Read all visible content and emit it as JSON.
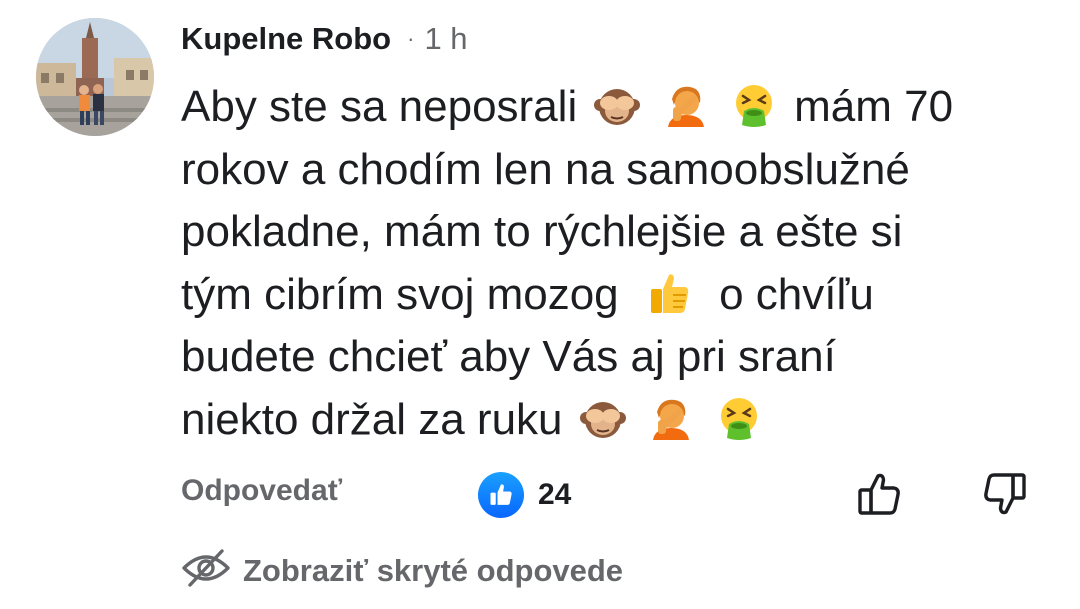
{
  "comment": {
    "author": "Kupelne Robo",
    "separator": "·",
    "time": "1 h",
    "lines": [
      {
        "before": "Aby ste sa neposrali",
        "emojis": [
          "see-no-evil-monkey",
          "person-facepalming",
          "face-vomiting"
        ],
        "after": "mám 70"
      },
      {
        "text": "rokov a chodím len na samoobslužné"
      },
      {
        "text": "pokladne, mám to rýchlejšie a ešte si"
      },
      {
        "before": "tým cibrím svoj mozog",
        "emojis": [
          "thumbs-up"
        ],
        "after": "o chvíľu"
      },
      {
        "text": "budete chcieť aby Vás aj pri sraní"
      },
      {
        "before": "niekto držal za ruku",
        "emojis": [
          "see-no-evil-monkey",
          "person-facepalming",
          "face-vomiting"
        ]
      }
    ]
  },
  "actions": {
    "reply_label": "Odpovedať",
    "reaction_count": "24",
    "reaction_icon": "like-reaction-icon",
    "thumb_up_icon": "thumb-up-outline-icon",
    "thumb_down_icon": "thumb-down-outline-icon"
  },
  "hidden_replies": {
    "label": "Zobraziť skryté odpovede",
    "icon": "eye-slash-icon"
  },
  "colors": {
    "text_primary": "#1c1e21",
    "text_secondary": "#65676b",
    "like_blue": "#0866ff"
  }
}
